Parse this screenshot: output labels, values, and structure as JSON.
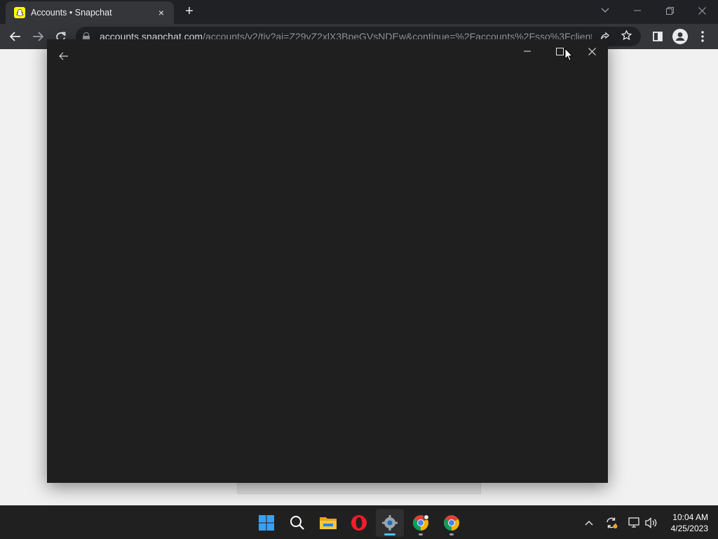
{
  "browser": {
    "tab_title": "Accounts • Snapchat",
    "tab_close_icon": "×",
    "new_tab_icon": "+",
    "url_host": "accounts.snapchat.com",
    "url_path": "/accounts/v2/tiv?ai=Z29vZ2xlX3BpeGVsNDEw&continue=%2Faccounts%2Fsso%3Fclient_i...",
    "window_controls": {
      "dropdown": "⌄",
      "minimize": "—",
      "restore": "❐",
      "close": "✕"
    },
    "nav": {
      "back": "←",
      "forward": "→",
      "reload": "↻"
    },
    "accent_favicon": "#fffc00"
  },
  "popup": {
    "back_icon": "←",
    "minimize": "—",
    "maximize": "☐",
    "close": "✕",
    "background": "#1f1f1f"
  },
  "taskbar": {
    "apps": [
      {
        "name": "start-button"
      },
      {
        "name": "search"
      },
      {
        "name": "file-explorer"
      },
      {
        "name": "opera"
      },
      {
        "name": "settings",
        "active": true
      },
      {
        "name": "chrome-profile"
      },
      {
        "name": "chrome"
      }
    ],
    "tray": {
      "chevron": "^",
      "volume": "🔊"
    },
    "clock": {
      "time": "10:04 AM",
      "date": "4/25/2023"
    }
  }
}
